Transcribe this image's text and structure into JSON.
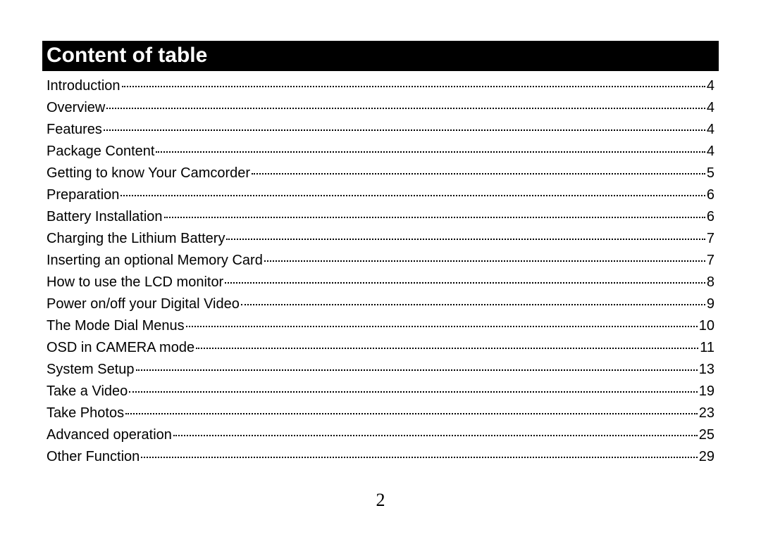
{
  "header": {
    "title": "Content of table"
  },
  "toc": {
    "entries": [
      {
        "title": "Introduction",
        "page": "4"
      },
      {
        "title": "Overview",
        "page": "4"
      },
      {
        "title": "Features",
        "page": "4"
      },
      {
        "title": "Package Content",
        "page": "4"
      },
      {
        "title": "Getting to know Your Camcorder",
        "page": "5"
      },
      {
        "title": "Preparation",
        "page": "6"
      },
      {
        "title": "Battery Installation",
        "page": "6"
      },
      {
        "title": "Charging the Lithium Battery",
        "page": "7"
      },
      {
        "title": "Inserting an optional Memory Card",
        "page": "7"
      },
      {
        "title": "How to use the LCD monitor",
        "page": "8"
      },
      {
        "title": "Power on/off your Digital Video",
        "page": "9"
      },
      {
        "title": "The Mode Dial Menus",
        "page": "10"
      },
      {
        "title": "OSD in CAMERA mode",
        "page": "11"
      },
      {
        "title": "System Setup",
        "page": "13"
      },
      {
        "title": "Take a Video",
        "page": "19"
      },
      {
        "title": "Take Photos",
        "page": "23"
      },
      {
        "title": "Advanced operation",
        "page": "25"
      },
      {
        "title": "Other Function",
        "page": "29"
      }
    ]
  },
  "footer": {
    "page_number": "2"
  }
}
